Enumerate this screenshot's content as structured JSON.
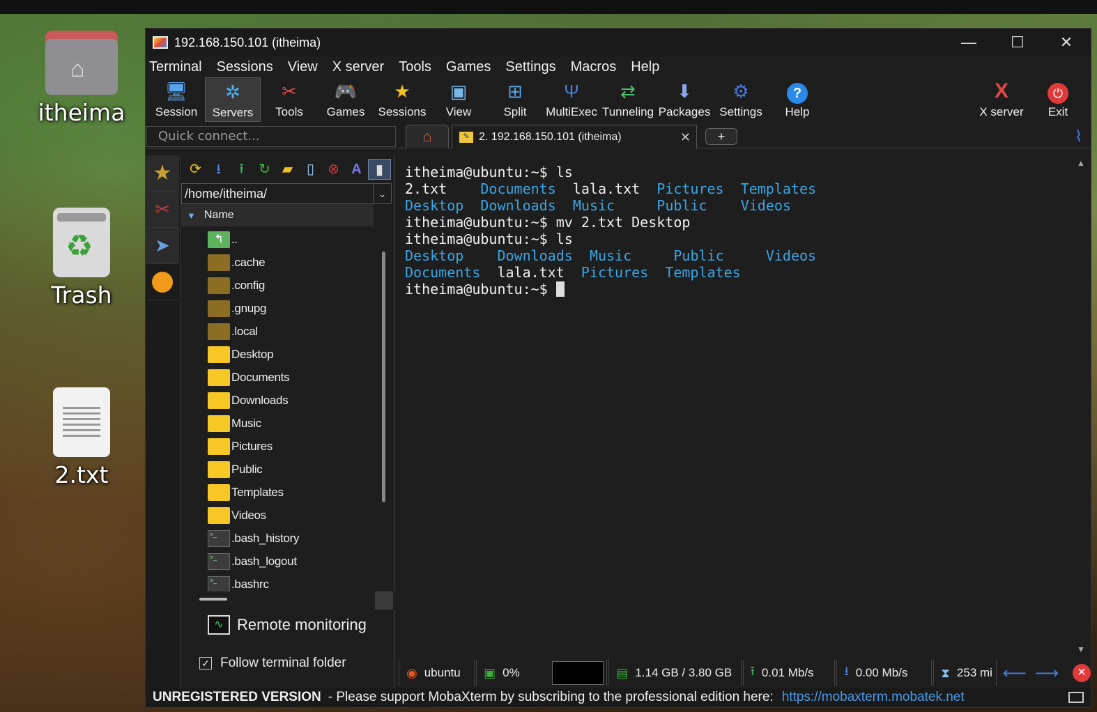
{
  "desktop": {
    "icons": [
      {
        "label": "itheima",
        "icon": "home-folder-icon"
      },
      {
        "label": "Trash",
        "icon": "trash-icon"
      },
      {
        "label": "2.txt",
        "icon": "text-file-icon"
      }
    ]
  },
  "window": {
    "title": "192.168.150.101 (itheima)",
    "controls": {
      "minimize": "—",
      "maximize": "☐",
      "close": "✕"
    }
  },
  "menu": [
    "Terminal",
    "Sessions",
    "View",
    "X server",
    "Tools",
    "Games",
    "Settings",
    "Macros",
    "Help"
  ],
  "toolbar": {
    "buttons": [
      {
        "label": "Session",
        "icon": "monitor-icon"
      },
      {
        "label": "Servers",
        "icon": "servers-icon",
        "active": true
      },
      {
        "label": "Tools",
        "icon": "tools-icon"
      },
      {
        "label": "Games",
        "icon": "gamepad-icon"
      },
      {
        "label": "Sessions",
        "icon": "star-icon"
      },
      {
        "label": "View",
        "icon": "view-icon"
      },
      {
        "label": "Split",
        "icon": "split-icon"
      },
      {
        "label": "MultiExec",
        "icon": "fork-icon"
      },
      {
        "label": "Tunneling",
        "icon": "tunnel-icon"
      },
      {
        "label": "Packages",
        "icon": "download-icon"
      },
      {
        "label": "Settings",
        "icon": "gears-icon"
      },
      {
        "label": "Help",
        "icon": "help-icon"
      }
    ],
    "right": [
      {
        "label": "X server",
        "icon": "x-server-icon"
      },
      {
        "label": "Exit",
        "icon": "power-icon"
      }
    ]
  },
  "tabs": {
    "quick_connect_placeholder": "Quick connect...",
    "session_tab": "2. 192.168.150.101 (itheima)",
    "new_tab": "+"
  },
  "filebrowser": {
    "path": "/home/itheima/",
    "column": "Name",
    "items": [
      {
        "name": "..",
        "type": "up"
      },
      {
        "name": ".cache",
        "type": "hidden-folder"
      },
      {
        "name": ".config",
        "type": "hidden-folder"
      },
      {
        "name": ".gnupg",
        "type": "hidden-folder"
      },
      {
        "name": ".local",
        "type": "hidden-folder"
      },
      {
        "name": "Desktop",
        "type": "folder"
      },
      {
        "name": "Documents",
        "type": "folder"
      },
      {
        "name": "Downloads",
        "type": "folder"
      },
      {
        "name": "Music",
        "type": "folder"
      },
      {
        "name": "Pictures",
        "type": "folder"
      },
      {
        "name": "Public",
        "type": "folder"
      },
      {
        "name": "Templates",
        "type": "folder"
      },
      {
        "name": "Videos",
        "type": "folder"
      },
      {
        "name": ".bash_history",
        "type": "file"
      },
      {
        "name": ".bash_logout",
        "type": "file"
      },
      {
        "name": ".bashrc",
        "type": "file"
      }
    ],
    "remote_monitoring": "Remote monitoring",
    "follow_terminal": "Follow terminal folder",
    "follow_checked": true
  },
  "terminal": {
    "lines": [
      [
        {
          "t": "itheima@ubuntu:~$ ls",
          "c": "plain"
        }
      ],
      [
        {
          "t": "2.txt    ",
          "c": "plain"
        },
        {
          "t": "Documents",
          "c": "dir"
        },
        {
          "t": "  lala.txt  ",
          "c": "plain"
        },
        {
          "t": "Pictures",
          "c": "dir"
        },
        {
          "t": "  ",
          "c": "plain"
        },
        {
          "t": "Templates",
          "c": "dir"
        }
      ],
      [
        {
          "t": "Desktop",
          "c": "dir"
        },
        {
          "t": "  ",
          "c": "plain"
        },
        {
          "t": "Downloads",
          "c": "dir"
        },
        {
          "t": "  ",
          "c": "plain"
        },
        {
          "t": "Music",
          "c": "dir"
        },
        {
          "t": "     ",
          "c": "plain"
        },
        {
          "t": "Public",
          "c": "dir"
        },
        {
          "t": "    ",
          "c": "plain"
        },
        {
          "t": "Videos",
          "c": "dir"
        }
      ],
      [
        {
          "t": "itheima@ubuntu:~$ mv 2.txt Desktop",
          "c": "plain"
        }
      ],
      [
        {
          "t": "itheima@ubuntu:~$ ls",
          "c": "plain"
        }
      ],
      [
        {
          "t": "Desktop",
          "c": "dir"
        },
        {
          "t": "    ",
          "c": "plain"
        },
        {
          "t": "Downloads",
          "c": "dir"
        },
        {
          "t": "  ",
          "c": "plain"
        },
        {
          "t": "Music",
          "c": "dir"
        },
        {
          "t": "     ",
          "c": "plain"
        },
        {
          "t": "Public",
          "c": "dir"
        },
        {
          "t": "     ",
          "c": "plain"
        },
        {
          "t": "Videos",
          "c": "dir"
        }
      ],
      [
        {
          "t": "Documents",
          "c": "dir"
        },
        {
          "t": "  lala.txt  ",
          "c": "plain"
        },
        {
          "t": "Pictures",
          "c": "dir"
        },
        {
          "t": "  ",
          "c": "plain"
        },
        {
          "t": "Templates",
          "c": "dir"
        }
      ],
      [
        {
          "t": "itheima@ubuntu:~$ ",
          "c": "plain"
        },
        {
          "t": "",
          "c": "cursor"
        }
      ]
    ],
    "dir_color": "#3aa6e6"
  },
  "statusbar": {
    "host": "ubuntu",
    "cpu": "0%",
    "memory": "1.14 GB / 3.80 GB",
    "upload": "0.01 Mb/s",
    "download": "0.00 Mb/s",
    "uptime": "253 mi"
  },
  "footer": {
    "unregistered": "UNREGISTERED VERSION",
    "message": "-  Please support MobaXterm by subscribing to the professional edition here:",
    "link": "https://mobaxterm.mobatek.net"
  }
}
